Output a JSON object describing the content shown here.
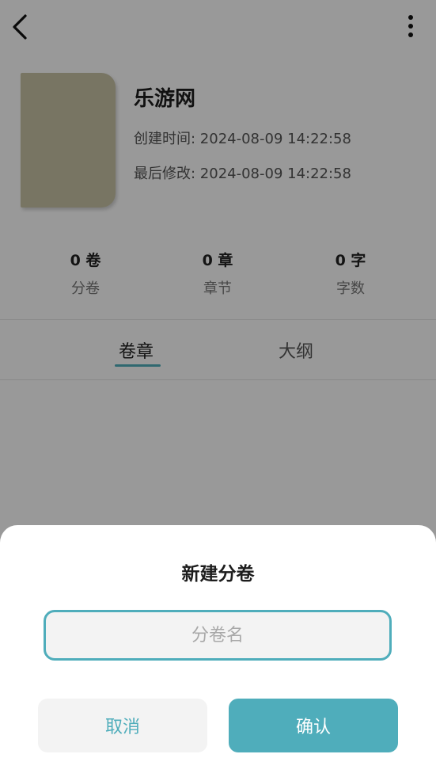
{
  "book": {
    "title": "乐游网",
    "created": "创建时间: 2024-08-09 14:22:58",
    "modified": "最后修改: 2024-08-09 14:22:58"
  },
  "stats": [
    {
      "value": "0 卷",
      "label": "分卷"
    },
    {
      "value": "0 章",
      "label": "章节"
    },
    {
      "value": "0 字",
      "label": "字数"
    }
  ],
  "tabs": [
    {
      "label": "卷章",
      "active": true
    },
    {
      "label": "大纲",
      "active": false
    }
  ],
  "dialog": {
    "title": "新建分卷",
    "input_placeholder": "分卷名",
    "input_value": "",
    "cancel_label": "取消",
    "confirm_label": "确认"
  },
  "colors": {
    "accent": "#4fadbb",
    "cover": "#c8c4a6"
  },
  "icons": {
    "back": "chevron-left-icon",
    "more": "more-vertical-icon"
  }
}
